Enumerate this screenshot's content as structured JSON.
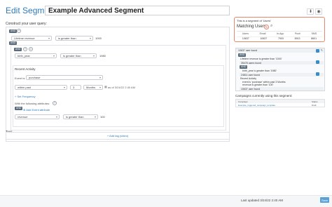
{
  "header": {
    "edit_label": "Edit Segment:",
    "segment_name": "Example Advanced Segment"
  },
  "query": {
    "title": "Construct your user query:",
    "and_tag": "AND",
    "row1": {
      "field": "Lifetime revenue",
      "operator": "is greater than",
      "value": "1000"
    },
    "nested_and_tag": "AND",
    "nested_and_tag2": "AND",
    "row2": {
      "field": "birth_year",
      "operator": "is greater than",
      "value": "1980"
    },
    "recent": {
      "title": "Recent Activity",
      "event_label": "Event is:",
      "event_value": "purchase",
      "timing": "within past",
      "count": "3",
      "unit": "Months",
      "date_note": "as of 3/24/22 2:40 AM",
      "set_frequency": "Set Frequency",
      "attributes_label": "With the following attributes:",
      "attr_and_tag": "AND",
      "add_attribute": "Add Event attribute",
      "attr_field": "revenue",
      "attr_operator": "is greater than",
      "attr_value": "100"
    }
  },
  "tags": {
    "label": "Tags",
    "add_label": "+ Add tag (video)"
  },
  "summary": {
    "segment_of": "This is a segment of 'Users'",
    "matching_label": "Matching Users",
    "columns": [
      "Users",
      "Email",
      "In-App",
      "Push",
      "SMS"
    ],
    "values": [
      "10637",
      "10637",
      "7903",
      "8913",
      "8601"
    ]
  },
  "breakdown": {
    "total": "10637 user found",
    "and1": "AND",
    "lifetime": "Lifetime revenue is greater than '1000'",
    "lifetime_found": "35478 users found",
    "and2": "AND",
    "birth": "birth_year is greater than '1980'",
    "birth_found": "24811 user found",
    "recent_title": "Recent Activity",
    "recent_desc1": "event is 'purchase' within past 3 Months",
    "recent_desc2": "revenue is greater than '100'",
    "recent_found": "10637 user found"
  },
  "campaigns": {
    "title": "Campaigns currently using this segment:",
    "columns": [
      "Campaign",
      "Status"
    ],
    "row": {
      "name": "Example_triggered_campaign_template",
      "status": "Draft"
    }
  },
  "footer": {
    "last_updated": "Last updated 3/24/22 2:40 AM",
    "save_label": "Save"
  },
  "colors": {
    "accent": "#3a8dcc",
    "highlight_border": "#e8866a",
    "save": "#5aa2d6"
  },
  "icons": [
    "download-icon",
    "eye-icon",
    "refresh-icon",
    "search-icon",
    "close-icon",
    "plus-icon",
    "calendar-icon",
    "chevron-down-icon",
    "edit-icon"
  ]
}
